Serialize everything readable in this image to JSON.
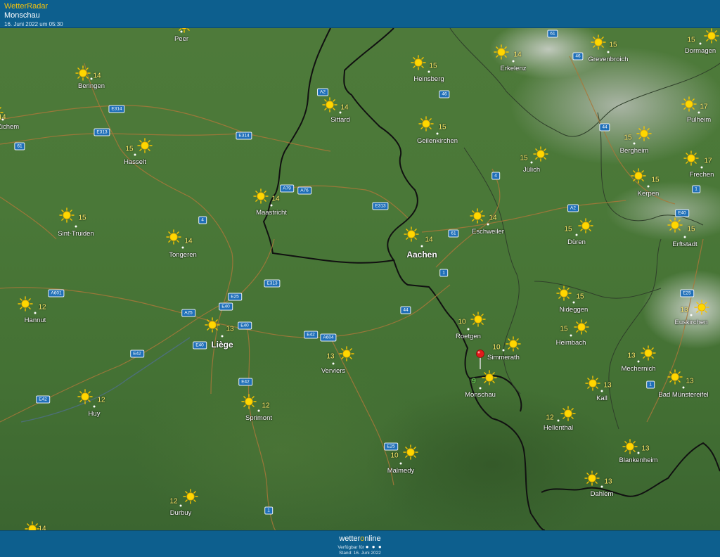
{
  "header": {
    "app_name": "WetterRadar",
    "location": "Monschau",
    "timestamp": "16. Juni 2022 um 05:30"
  },
  "footer": {
    "brand_pre": "wetter",
    "brand_o": "o",
    "brand_post": "nline",
    "available_label": "Verfügbar für",
    "platform_icons": "● ● ●",
    "status": "Stand: 16. Juni 2022"
  },
  "colors": {
    "header_bg": "#0d5f8e",
    "brand_accent": "#f4c20d",
    "temp_text": "#ffe96a",
    "selected_temp": "#7dff6a",
    "road_shield": "#1f6fb8",
    "pin": "#e01b1b"
  },
  "selected_location": {
    "name": "Monschau",
    "temp": "9"
  },
  "cities": [
    {
      "name": "Peer",
      "temp": "13"
    },
    {
      "name": "Beringen",
      "temp": "14"
    },
    {
      "name": "vel-Zichem",
      "temp": "14"
    },
    {
      "name": "Hasselt",
      "temp": "15"
    },
    {
      "name": "Sint-Truiden",
      "temp": "15"
    },
    {
      "name": "Tongeren",
      "temp": "14"
    },
    {
      "name": "Hannut",
      "temp": "12"
    },
    {
      "name": "Liège",
      "temp": "13"
    },
    {
      "name": "Huy",
      "temp": "12"
    },
    {
      "name": "Sprimont",
      "temp": "12"
    },
    {
      "name": "Durbuy",
      "temp": "12"
    },
    {
      "name": "Maastricht",
      "temp": "14"
    },
    {
      "name": "Sittard",
      "temp": "14"
    },
    {
      "name": "Heinsberg",
      "temp": "15"
    },
    {
      "name": "Erkelenz",
      "temp": "14"
    },
    {
      "name": "Geilenkirchen",
      "temp": "15"
    },
    {
      "name": "Aachen",
      "temp": "14"
    },
    {
      "name": "Eschweiler",
      "temp": "14"
    },
    {
      "name": "Jülich",
      "temp": "15"
    },
    {
      "name": "Verviers",
      "temp": "13"
    },
    {
      "name": "Roetgen",
      "temp": "10"
    },
    {
      "name": "Simmerath",
      "temp": "10"
    },
    {
      "name": "Malmedy",
      "temp": "10"
    },
    {
      "name": "Grevenbroich",
      "temp": "15"
    },
    {
      "name": "Dormagen",
      "temp": "15"
    },
    {
      "name": "Pulheim",
      "temp": "17"
    },
    {
      "name": "Bergheim",
      "temp": "15"
    },
    {
      "name": "Frechen",
      "temp": "17"
    },
    {
      "name": "Kerpen",
      "temp": "15"
    },
    {
      "name": "Erftstadt",
      "temp": "15"
    },
    {
      "name": "Düren",
      "temp": "15"
    },
    {
      "name": "Nideggen",
      "temp": "15"
    },
    {
      "name": "Heimbach",
      "temp": "15"
    },
    {
      "name": "Euskirchen",
      "temp": "13"
    },
    {
      "name": "Mechernich",
      "temp": "13"
    },
    {
      "name": "Kall",
      "temp": "13"
    },
    {
      "name": "Bad Münstereifel",
      "temp": "13"
    },
    {
      "name": "Hellenthal",
      "temp": "12"
    },
    {
      "name": "Blankenheim",
      "temp": "13"
    },
    {
      "name": "Dahlem",
      "temp": "13"
    },
    {
      "name": "",
      "temp": "14"
    }
  ],
  "roads": [
    "61",
    "46",
    "A2",
    "46",
    "E314",
    "E313",
    "E314",
    "61",
    "44",
    "4",
    "A2",
    "A79",
    "A76",
    "E313",
    "4",
    "61",
    "E40",
    "A601",
    "E25",
    "E313",
    "E40",
    "A25",
    "E40",
    "E42",
    "A604",
    "E42",
    "E40",
    "44",
    "1",
    "1",
    "E25",
    "E42",
    "E42",
    "E25",
    "1",
    "1"
  ]
}
